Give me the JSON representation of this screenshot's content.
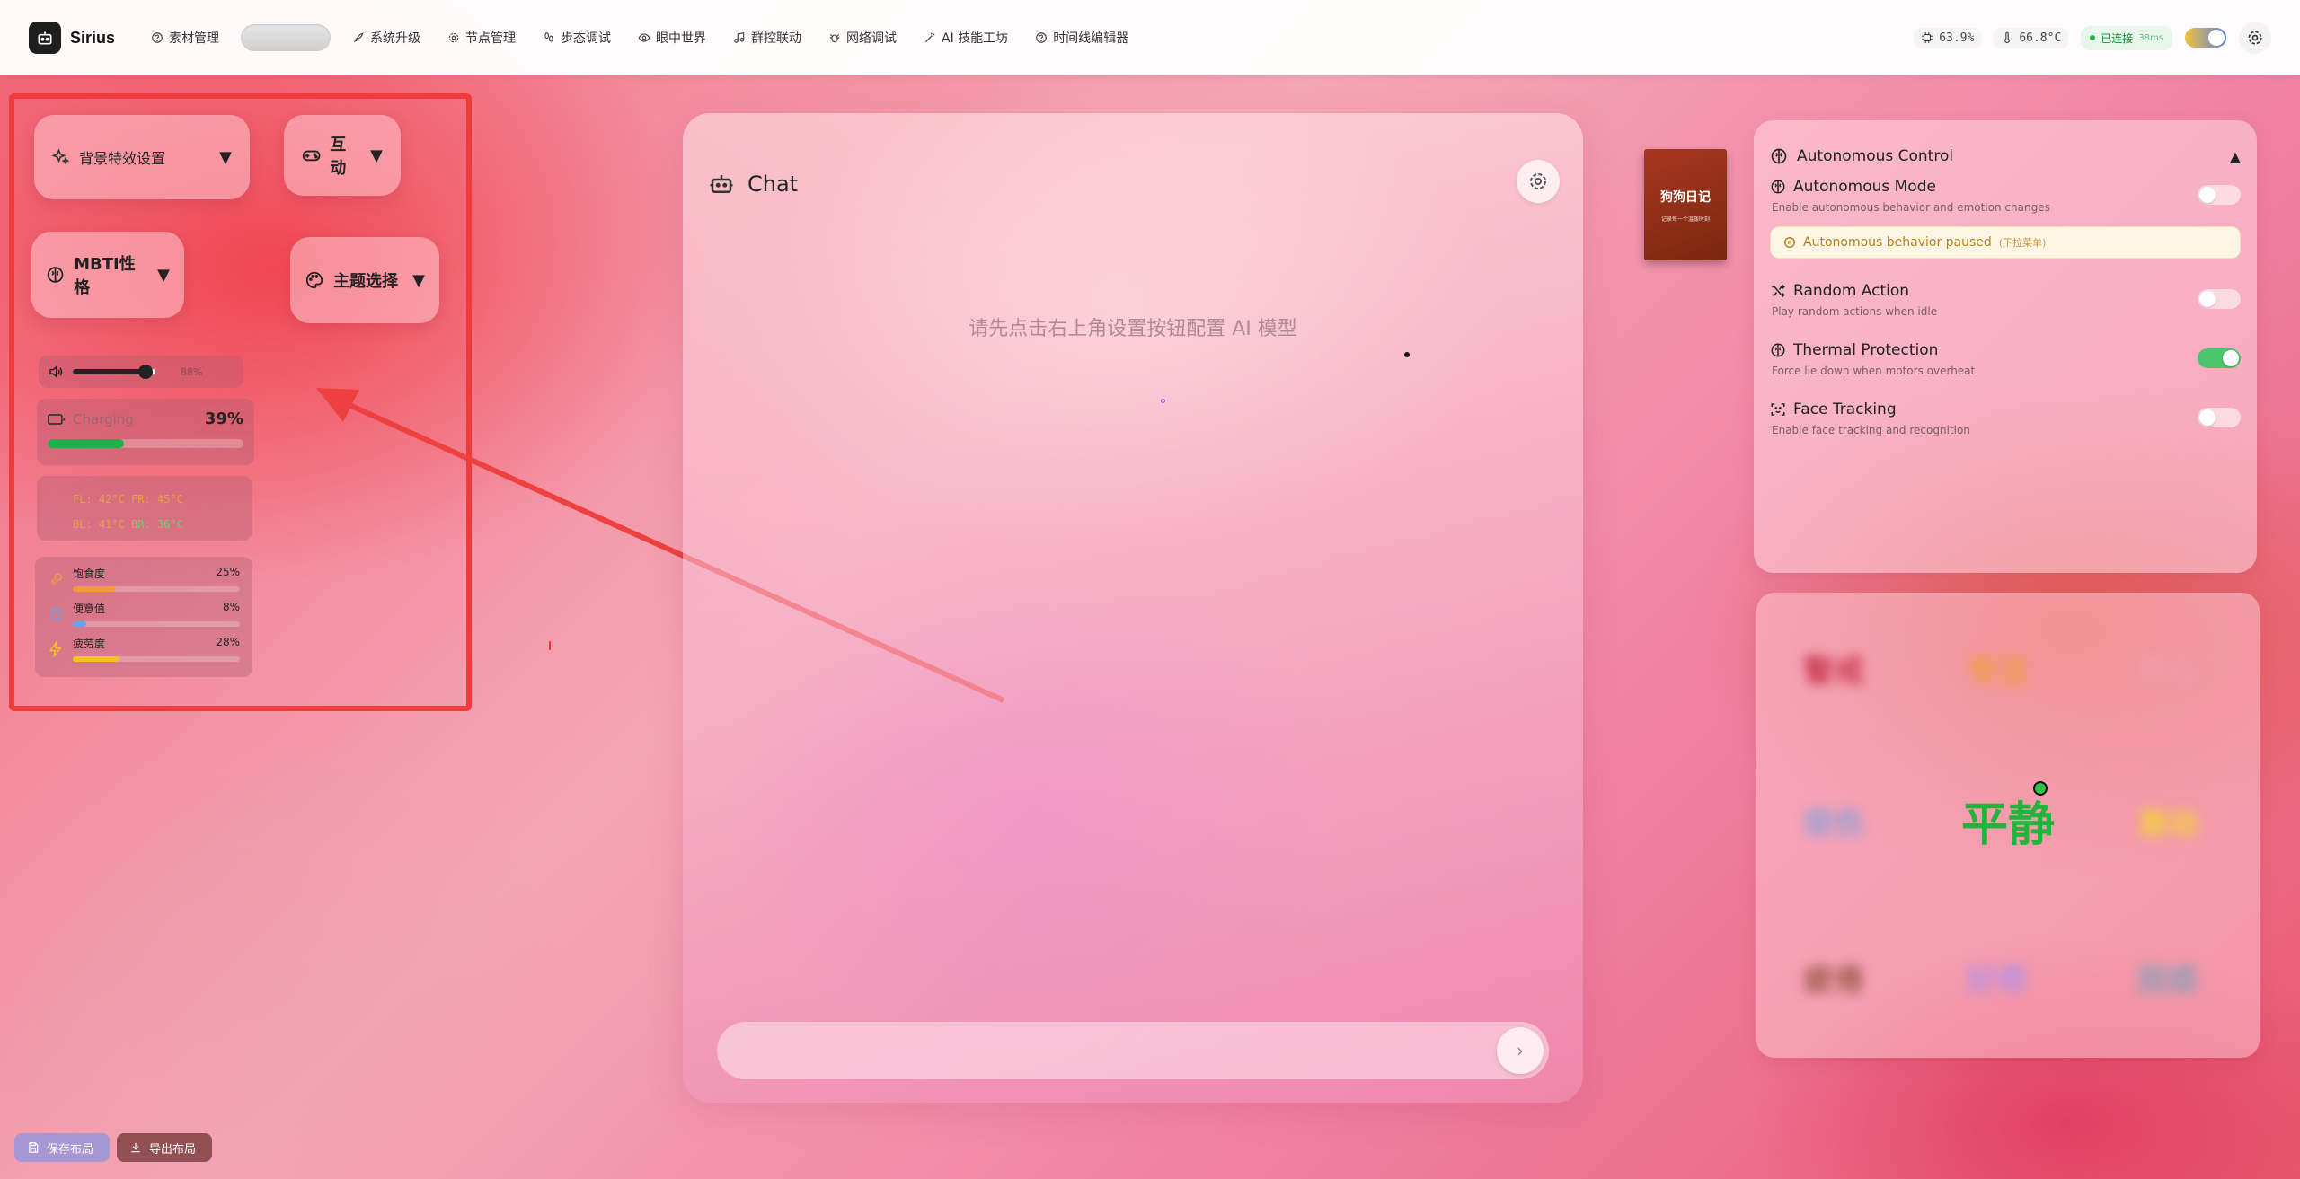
{
  "app": {
    "name": "Sirius"
  },
  "nav": {
    "items": [
      {
        "label": "素材管理",
        "icon": "help-circle-icon"
      },
      {
        "label": "系统升级",
        "icon": "rocket-icon"
      },
      {
        "label": "节点管理",
        "icon": "gear-icon"
      },
      {
        "label": "步态调试",
        "icon": "footprints-icon"
      },
      {
        "label": "眼中世界",
        "icon": "eye-icon"
      },
      {
        "label": "群控联动",
        "icon": "music-icon"
      },
      {
        "label": "网络调试",
        "icon": "bug-icon"
      },
      {
        "label": "AI 技能工坊",
        "icon": "wand-icon"
      },
      {
        "label": "时间线编辑器",
        "icon": "help-circle-icon"
      }
    ]
  },
  "status": {
    "cpu": "63.9%",
    "temp": "66.8°C",
    "connection": "已连接",
    "latency": "38ms"
  },
  "left": {
    "bg_effects": "背景特效设置",
    "interact": "互动",
    "mbti": "MBTI性格",
    "theme": "主题选择",
    "caret": "▼",
    "volume": {
      "value": 88,
      "label": "88%"
    },
    "battery": {
      "label": "Charging",
      "percent": 39,
      "percent_label": "39%",
      "color": "#22b04b"
    },
    "temps": {
      "fl": "FL: 42°C",
      "fr": "FR: 45°C",
      "bl": "BL: 41°C",
      "br": "BR: 36°C"
    },
    "needs": [
      {
        "label": "饱食度",
        "value": 25,
        "value_label": "25%",
        "color": "#f39a3a"
      },
      {
        "label": "便意值",
        "value": 8,
        "value_label": "8%",
        "color": "#6aa0ee"
      },
      {
        "label": "疲劳度",
        "value": 28,
        "value_label": "28%",
        "color": "#f4c21f"
      }
    ]
  },
  "chat": {
    "title": "Chat",
    "hint": "请先点击右上角设置按钮配置 AI 模型",
    "input_placeholder": "",
    "send": "›"
  },
  "book": {
    "title": "狗狗日记",
    "subtitle": "记录每一个温暖时刻"
  },
  "autonomous": {
    "title": "Autonomous Control",
    "collapse": "▲",
    "mode_title": "Autonomous Mode",
    "mode_desc": "Enable autonomous behavior and emotion changes",
    "paused": "Autonomous behavior paused",
    "paused_hint": "(下拉菜单)",
    "settings": [
      {
        "title": "Random Action",
        "desc": "Play random actions when idle",
        "on": false
      },
      {
        "title": "Thermal Protection",
        "desc": "Force lie down when motors overheat",
        "on": true
      },
      {
        "title": "Face Tracking",
        "desc": "Enable face tracking and recognition",
        "on": false
      }
    ]
  },
  "emotions": {
    "active": "平静",
    "items": [
      {
        "label": "警戒",
        "color": "#c8374d"
      },
      {
        "label": "专注",
        "color": "#f0a030"
      },
      {
        "label": "开心",
        "color": "#f4a0b0"
      },
      {
        "label": "悲伤",
        "color": "#8aa0d8"
      },
      {
        "label": "激动",
        "color": "#f2d23a"
      },
      {
        "label": "疲倦",
        "color": "#9a5a48"
      },
      {
        "label": "好奇",
        "color": "#b090e8"
      },
      {
        "label": "困惑",
        "color": "#8aa0b8"
      }
    ]
  },
  "bottom": {
    "save": "保存布局",
    "export": "导出布局"
  }
}
